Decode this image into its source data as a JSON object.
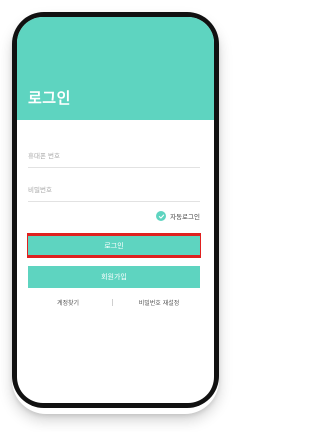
{
  "header": {
    "title": "로그인",
    "color": "#5ed4c0"
  },
  "form": {
    "phone_placeholder": "휴대폰 번호",
    "password_placeholder": "비밀번호",
    "auto_login_label": "자동로그인",
    "auto_login_checked": true
  },
  "buttons": {
    "login_label": "로그인",
    "signup_label": "회원가입",
    "highlight_color": "#e0201f"
  },
  "links": {
    "find_account": "계정찾기",
    "reset_password": "비밀번호 재설정"
  },
  "icons": {
    "auto_login_check": "check-circle-icon"
  }
}
